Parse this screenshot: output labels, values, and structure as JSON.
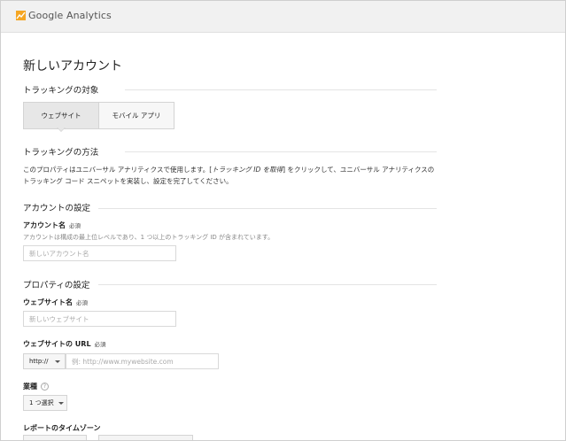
{
  "app": {
    "brand": "Google Analytics",
    "brand_colors": {
      "logo_orange": "#f5a623",
      "logo_dark_orange": "#e8710a"
    }
  },
  "page": {
    "title": "新しいアカウント"
  },
  "tracking_target": {
    "heading": "トラッキングの対象",
    "tabs": [
      {
        "label": "ウェブサイト",
        "selected": true
      },
      {
        "label": "モバイル アプリ",
        "selected": false
      }
    ]
  },
  "tracking_method": {
    "heading": "トラッキングの方法",
    "text_before": "このプロパティはユニバーサル アナリティクスで使用します。[",
    "link_text": "トラッキング ID を取得",
    "text_after": "] をクリックして、ユニバーサル アナリティクスのトラッキング コード スニペットを実装し、設定を完了してください。"
  },
  "account_settings": {
    "heading": "アカウントの設定",
    "account_name_label": "アカウント名",
    "required": "必須",
    "account_name_hint": "アカウントは構成の最上位レベルであり、1 つ以上のトラッキング ID が含まれています。",
    "account_name_placeholder": "新しいアカウント名"
  },
  "property_settings": {
    "heading": "プロパティの設定",
    "website_name_label": "ウェブサイト名",
    "website_name_placeholder": "新しいウェブサイト",
    "url_label": "ウェブサイトの URL",
    "protocol_value": "http://",
    "url_placeholder": "例: http://www.mywebsite.com",
    "industry_label": "業種",
    "industry_help_icon": "?",
    "industry_value": "1 つ選択",
    "timezone_label": "レポートのタイムゾーン"
  }
}
